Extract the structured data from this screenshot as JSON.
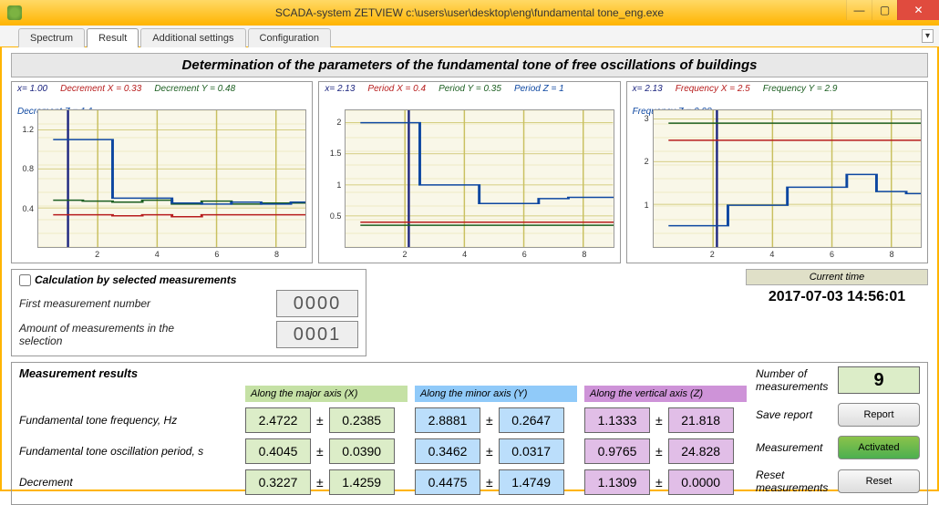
{
  "window": {
    "title": "SCADA-system ZETVIEW c:\\users\\user\\desktop\\eng\\fundamental tone_eng.exe"
  },
  "tabs": {
    "items": [
      "Spectrum",
      "Result",
      "Additional settings",
      "Configuration"
    ],
    "active_index": 1
  },
  "main_title": "Determination of the parameters of the fundamental tone of free oscillations of buildings",
  "charts": [
    {
      "readouts": [
        {
          "cls": "hdr-x",
          "text": "x=  1.00"
        },
        {
          "cls": "hdr-red",
          "text": "Decrement X = 0.33"
        },
        {
          "cls": "hdr-green",
          "text": "Decrement Y = 0.48"
        },
        {
          "cls": "hdr-blue",
          "text": "Decrement Z = 1.1"
        }
      ],
      "yticks": [
        "1.2",
        "0.8",
        "0.4"
      ],
      "xticks": [
        "2",
        "4",
        "6",
        "8"
      ]
    },
    {
      "readouts": [
        {
          "cls": "hdr-x",
          "text": "x=  2.13"
        },
        {
          "cls": "hdr-red",
          "text": "Period X = 0.4"
        },
        {
          "cls": "hdr-green",
          "text": "Period Y = 0.35"
        },
        {
          "cls": "hdr-blue",
          "text": "Period Z = 1"
        }
      ],
      "yticks": [
        "2",
        "1.5",
        "1",
        "0.5"
      ],
      "xticks": [
        "2",
        "4",
        "6",
        "8"
      ]
    },
    {
      "readouts": [
        {
          "cls": "hdr-x",
          "text": "x=  2.13"
        },
        {
          "cls": "hdr-red",
          "text": "Frequency X = 2.5"
        },
        {
          "cls": "hdr-green",
          "text": "Frequency Y = 2.9"
        },
        {
          "cls": "hdr-blue",
          "text": "Frequency Z = 0.98"
        }
      ],
      "yticks": [
        "3",
        "2",
        "1"
      ],
      "xticks": [
        "2",
        "4",
        "6",
        "8"
      ]
    }
  ],
  "chart_data": [
    {
      "type": "line",
      "title": "Decrement",
      "xlim": [
        0,
        9
      ],
      "ylim": [
        0,
        1.4
      ],
      "cursor_x": 1.0,
      "series": [
        {
          "name": "Decrement X",
          "color": "#b71c1c",
          "values_y": [
            0.33,
            0.33,
            0.32,
            0.33,
            0.31,
            0.33,
            0.33,
            0.33,
            0.33
          ]
        },
        {
          "name": "Decrement Y",
          "color": "#1b5e20",
          "values_y": [
            0.48,
            0.47,
            0.46,
            0.48,
            0.44,
            0.47,
            0.44,
            0.45,
            0.45
          ]
        },
        {
          "name": "Decrement Z",
          "color": "#0d47a1",
          "values_y": [
            1.1,
            1.1,
            0.5,
            0.5,
            0.45,
            0.44,
            0.46,
            0.44,
            0.46
          ]
        }
      ]
    },
    {
      "type": "line",
      "title": "Period",
      "xlim": [
        0,
        9
      ],
      "ylim": [
        0,
        2.2
      ],
      "cursor_x": 2.13,
      "series": [
        {
          "name": "Period X",
          "color": "#b71c1c",
          "values_y": [
            0.4,
            0.4,
            0.4,
            0.4,
            0.4,
            0.4,
            0.4,
            0.4,
            0.4
          ]
        },
        {
          "name": "Period Y",
          "color": "#1b5e20",
          "values_y": [
            0.35,
            0.35,
            0.35,
            0.35,
            0.35,
            0.35,
            0.35,
            0.35,
            0.35
          ]
        },
        {
          "name": "Period Z",
          "color": "#0d47a1",
          "values_y": [
            2.0,
            2.0,
            1.0,
            1.0,
            0.7,
            0.7,
            0.78,
            0.8,
            0.8
          ]
        }
      ]
    },
    {
      "type": "line",
      "title": "Frequency",
      "xlim": [
        0,
        9
      ],
      "ylim": [
        0,
        3.2
      ],
      "cursor_x": 2.13,
      "series": [
        {
          "name": "Frequency X",
          "color": "#b71c1c",
          "values_y": [
            2.5,
            2.5,
            2.5,
            2.5,
            2.5,
            2.5,
            2.5,
            2.5,
            2.5
          ]
        },
        {
          "name": "Frequency Y",
          "color": "#1b5e20",
          "values_y": [
            2.9,
            2.9,
            2.9,
            2.9,
            2.9,
            2.9,
            2.9,
            2.9,
            2.9
          ]
        },
        {
          "name": "Frequency Z",
          "color": "#0d47a1",
          "values_y": [
            0.5,
            0.5,
            0.98,
            0.98,
            1.4,
            1.4,
            1.7,
            1.3,
            1.25
          ]
        }
      ]
    }
  ],
  "calc": {
    "checkbox_label": "Calculation by selected measurements",
    "first_label": "First measurement number",
    "first_value": "0000",
    "amount_label": "Amount of measurements in the selection",
    "amount_value": "0001"
  },
  "time": {
    "label": "Current time",
    "value": "2017-07-03 14:56:01"
  },
  "results": {
    "title": "Measurement results",
    "axis_headers": [
      "Along the major axis (X)",
      "Along the minor axis (Y)",
      "Along the vertical axis (Z)"
    ],
    "rows": [
      {
        "label": "Fundamental tone frequency, Hz",
        "x": [
          "2.4722",
          "0.2385"
        ],
        "y": [
          "2.8881",
          "0.2647"
        ],
        "z": [
          "1.1333",
          "21.818"
        ]
      },
      {
        "label": "Fundamental tone oscillation period, s",
        "x": [
          "0.4045",
          "0.0390"
        ],
        "y": [
          "0.3462",
          "0.0317"
        ],
        "z": [
          "0.9765",
          "24.828"
        ]
      },
      {
        "label": "Decrement",
        "x": [
          "0.3227",
          "1.4259"
        ],
        "y": [
          "0.4475",
          "1.4749"
        ],
        "z": [
          "1.1309",
          "0.0000"
        ]
      }
    ]
  },
  "side": {
    "num_meas_label": "Number of measurements",
    "num_meas_value": "9",
    "save_label": "Save report",
    "report_btn": "Report",
    "meas_label": "Measurement",
    "activated_btn": "Activated",
    "reset_label": "Reset measurements",
    "reset_btn": "Reset"
  }
}
